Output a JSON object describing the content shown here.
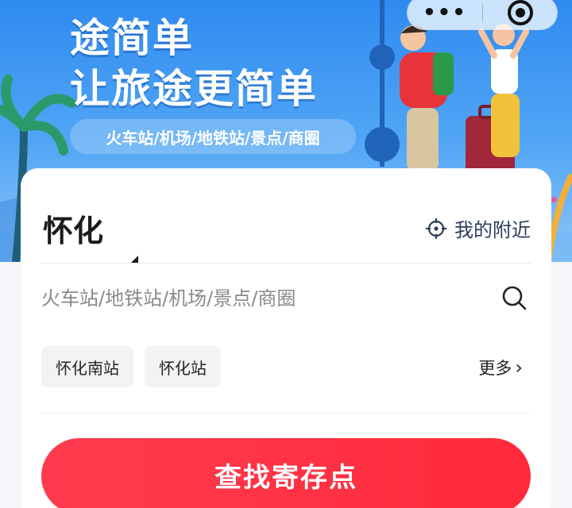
{
  "banner": {
    "title_line1": "途简单",
    "title_line2": "让旅途更简单",
    "tag_pill": "火车站/机场/地铁站/景点/商圈",
    "menu_icon": "more-dots-icon",
    "close_icon": "target-close-icon"
  },
  "form": {
    "city": "怀化",
    "nearby_label": "我的附近",
    "nearby_icon": "location-crosshair-icon",
    "search_placeholder": "火车站/地铁站/机场/景点/商圈",
    "search_icon": "search-icon",
    "chips": [
      "怀化南站",
      "怀化站"
    ],
    "more_label": "更多",
    "cta_label": "查找寄存点"
  },
  "colors": {
    "banner_blue": "#2f8bf0",
    "cta_red": "#ff2a3b",
    "nearby_text": "#2d3e5a"
  }
}
